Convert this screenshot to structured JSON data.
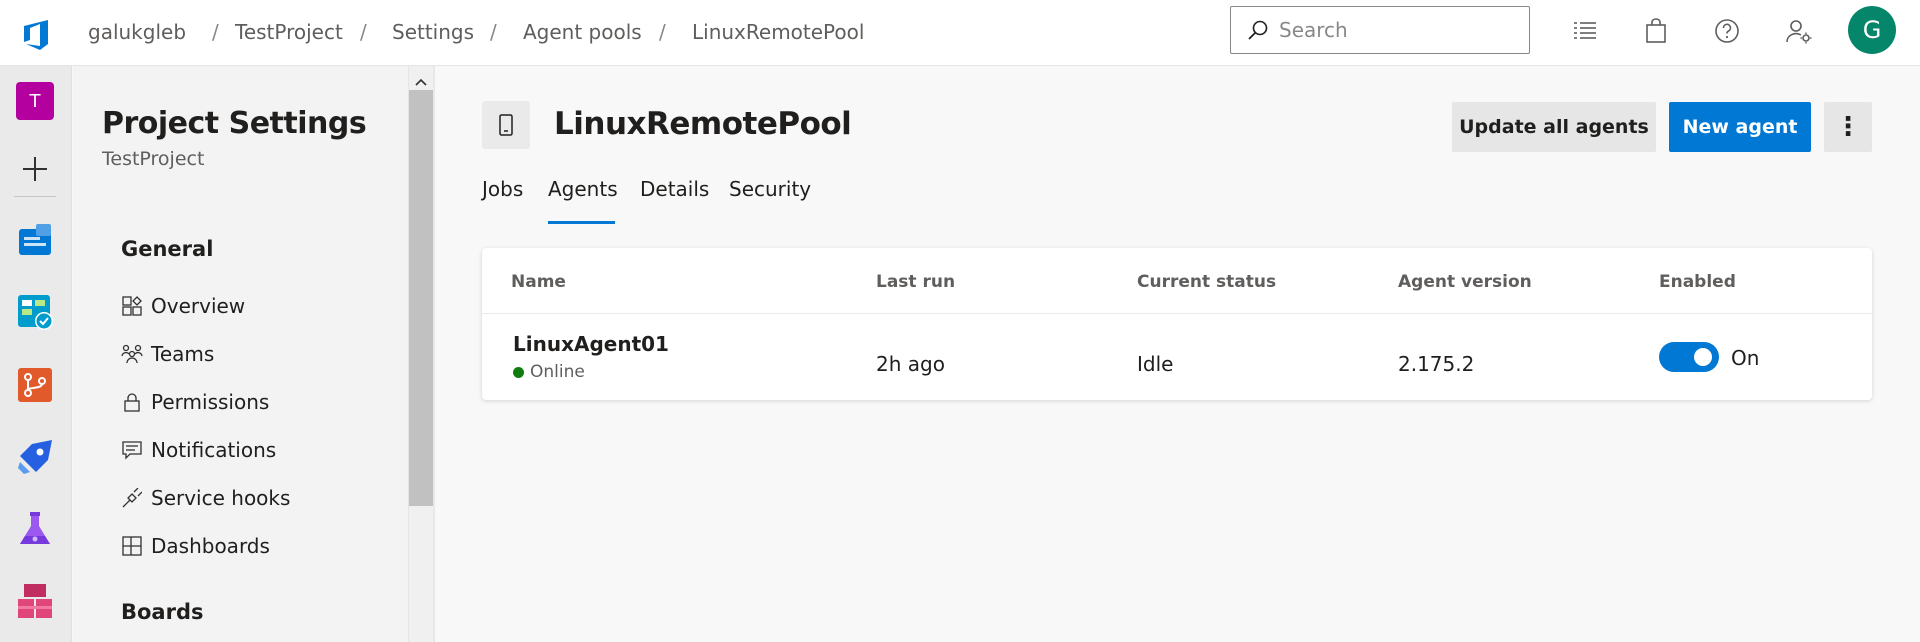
{
  "breadcrumb": [
    "galukgleb",
    "TestProject",
    "Settings",
    "Agent pools",
    "LinuxRemotePool"
  ],
  "breadcrumb_separator": "/",
  "search": {
    "placeholder": "Search"
  },
  "header_icons": [
    "task-list-icon",
    "shopping-bag-icon",
    "help-icon",
    "user-settings-icon"
  ],
  "user": {
    "avatar_initial": "G",
    "avatar_color": "#058569"
  },
  "rail": {
    "project_initial": "T",
    "items": [
      "project-tile",
      "add-icon",
      "overview-icon",
      "boards-icon",
      "repos-icon",
      "pipelines-icon",
      "test-plans-icon",
      "artifacts-icon"
    ]
  },
  "settings": {
    "title": "Project Settings",
    "project": "TestProject",
    "sections": [
      {
        "heading": "General",
        "items": [
          {
            "label": "Overview",
            "icon": "overview-icon"
          },
          {
            "label": "Teams",
            "icon": "teams-icon"
          },
          {
            "label": "Permissions",
            "icon": "lock-icon"
          },
          {
            "label": "Notifications",
            "icon": "notification-icon"
          },
          {
            "label": "Service hooks",
            "icon": "plug-icon"
          },
          {
            "label": "Dashboards",
            "icon": "dashboard-icon"
          }
        ]
      },
      {
        "heading": "Boards",
        "items": []
      }
    ]
  },
  "pool": {
    "title": "LinuxRemotePool",
    "icon": "device-icon",
    "actions": {
      "update": "Update all agents",
      "new": "New agent",
      "more": "⋮"
    },
    "tabs": [
      "Jobs",
      "Agents",
      "Details",
      "Security"
    ],
    "active_tab": "Agents"
  },
  "agents_table": {
    "columns": [
      "Name",
      "Last run",
      "Current status",
      "Agent version",
      "Enabled"
    ],
    "rows": [
      {
        "name": "LinuxAgent01",
        "status": "Online",
        "last_run": "2h ago",
        "current_status": "Idle",
        "agent_version": "2.175.2",
        "enabled": "On"
      }
    ]
  },
  "colors": {
    "accent": "#0078d4",
    "online": "#107c10",
    "project_tile": "#b4009e"
  }
}
